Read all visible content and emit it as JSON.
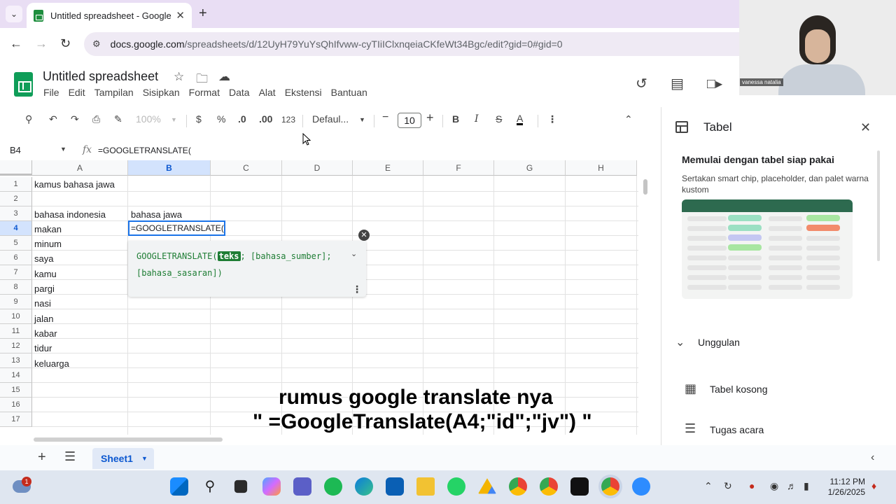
{
  "browser": {
    "tab_title": "Untitled spreadsheet - Google S",
    "url_host": "docs.google.com",
    "url_path": "/spreadsheets/d/12UyH79YuYsQhIfvww-cyTIiIClxnqeiaCKfeWt34Bgc/edit?gid=0#gid=0"
  },
  "webcam": {
    "name": "vanessa natalia"
  },
  "sheets": {
    "title": "Untitled spreadsheet",
    "menu": [
      "File",
      "Edit",
      "Tampilan",
      "Sisipkan",
      "Format",
      "Data",
      "Alat",
      "Ekstensi",
      "Bantuan"
    ],
    "toolbar": {
      "zoom": "100%",
      "currency": "$",
      "percent": "%",
      "dec_decrease": ".0",
      "dec_increase": ".00",
      "number_format": "123",
      "font": "Defaul...",
      "font_size": "10",
      "bold": "B",
      "italic": "I",
      "strike": "S",
      "text_color": "A"
    },
    "name_box": "B4",
    "formula": "=GOOGLETRANSLATE(",
    "columns": [
      "A",
      "B",
      "C",
      "D",
      "E",
      "F",
      "G",
      "H"
    ],
    "rows": [
      "1",
      "2",
      "3",
      "4",
      "5",
      "6",
      "7",
      "8",
      "9",
      "10",
      "11",
      "12",
      "13",
      "14",
      "15",
      "16",
      "17"
    ],
    "cells": {
      "A1": "kamus bahasa jawa",
      "A3": "bahasa indonesia",
      "B3": "bahasa jawa",
      "A4": "makan",
      "A5": "minum",
      "A6": "saya",
      "A7": "kamu",
      "A8": "pargi",
      "A9": "nasi",
      "A10": "jalan",
      "A11": "kabar",
      "A12": "tidur",
      "A13": "keluarga"
    },
    "active_cell_value": "=GOOGLETRANSLATE(",
    "formula_help": {
      "fn": "GOOGLETRANSLATE(",
      "arg_active": "teks",
      "rest_line1": "; [bahasa_sumber];",
      "line2": "[bahasa_sasaran])"
    },
    "sheet_tab": "Sheet1"
  },
  "side_panel": {
    "title": "Tabel",
    "heading": "Memulai dengan tabel siap pakai",
    "description": "Sertakan smart chip, placeholder, dan palet warna kustom",
    "preview_header_color": "#2d6a4f",
    "section": "Unggulan",
    "items": [
      "Tabel kosong",
      "Tugas acara"
    ]
  },
  "caption": {
    "line1": "rumus google translate nya",
    "line2": "\" =GoogleTranslate(A4;\"id\";\"jv\") \""
  },
  "taskbar": {
    "notification_count": "1",
    "time": "11:12 PM",
    "date": "1/26/2025",
    "apps": [
      "start",
      "search",
      "task-view",
      "copilot",
      "teams",
      "spotify",
      "edge",
      "store",
      "file-explorer",
      "whatsapp",
      "google-drive",
      "chrome-profile",
      "chrome",
      "capcut",
      "chrome-active",
      "zoom"
    ]
  }
}
